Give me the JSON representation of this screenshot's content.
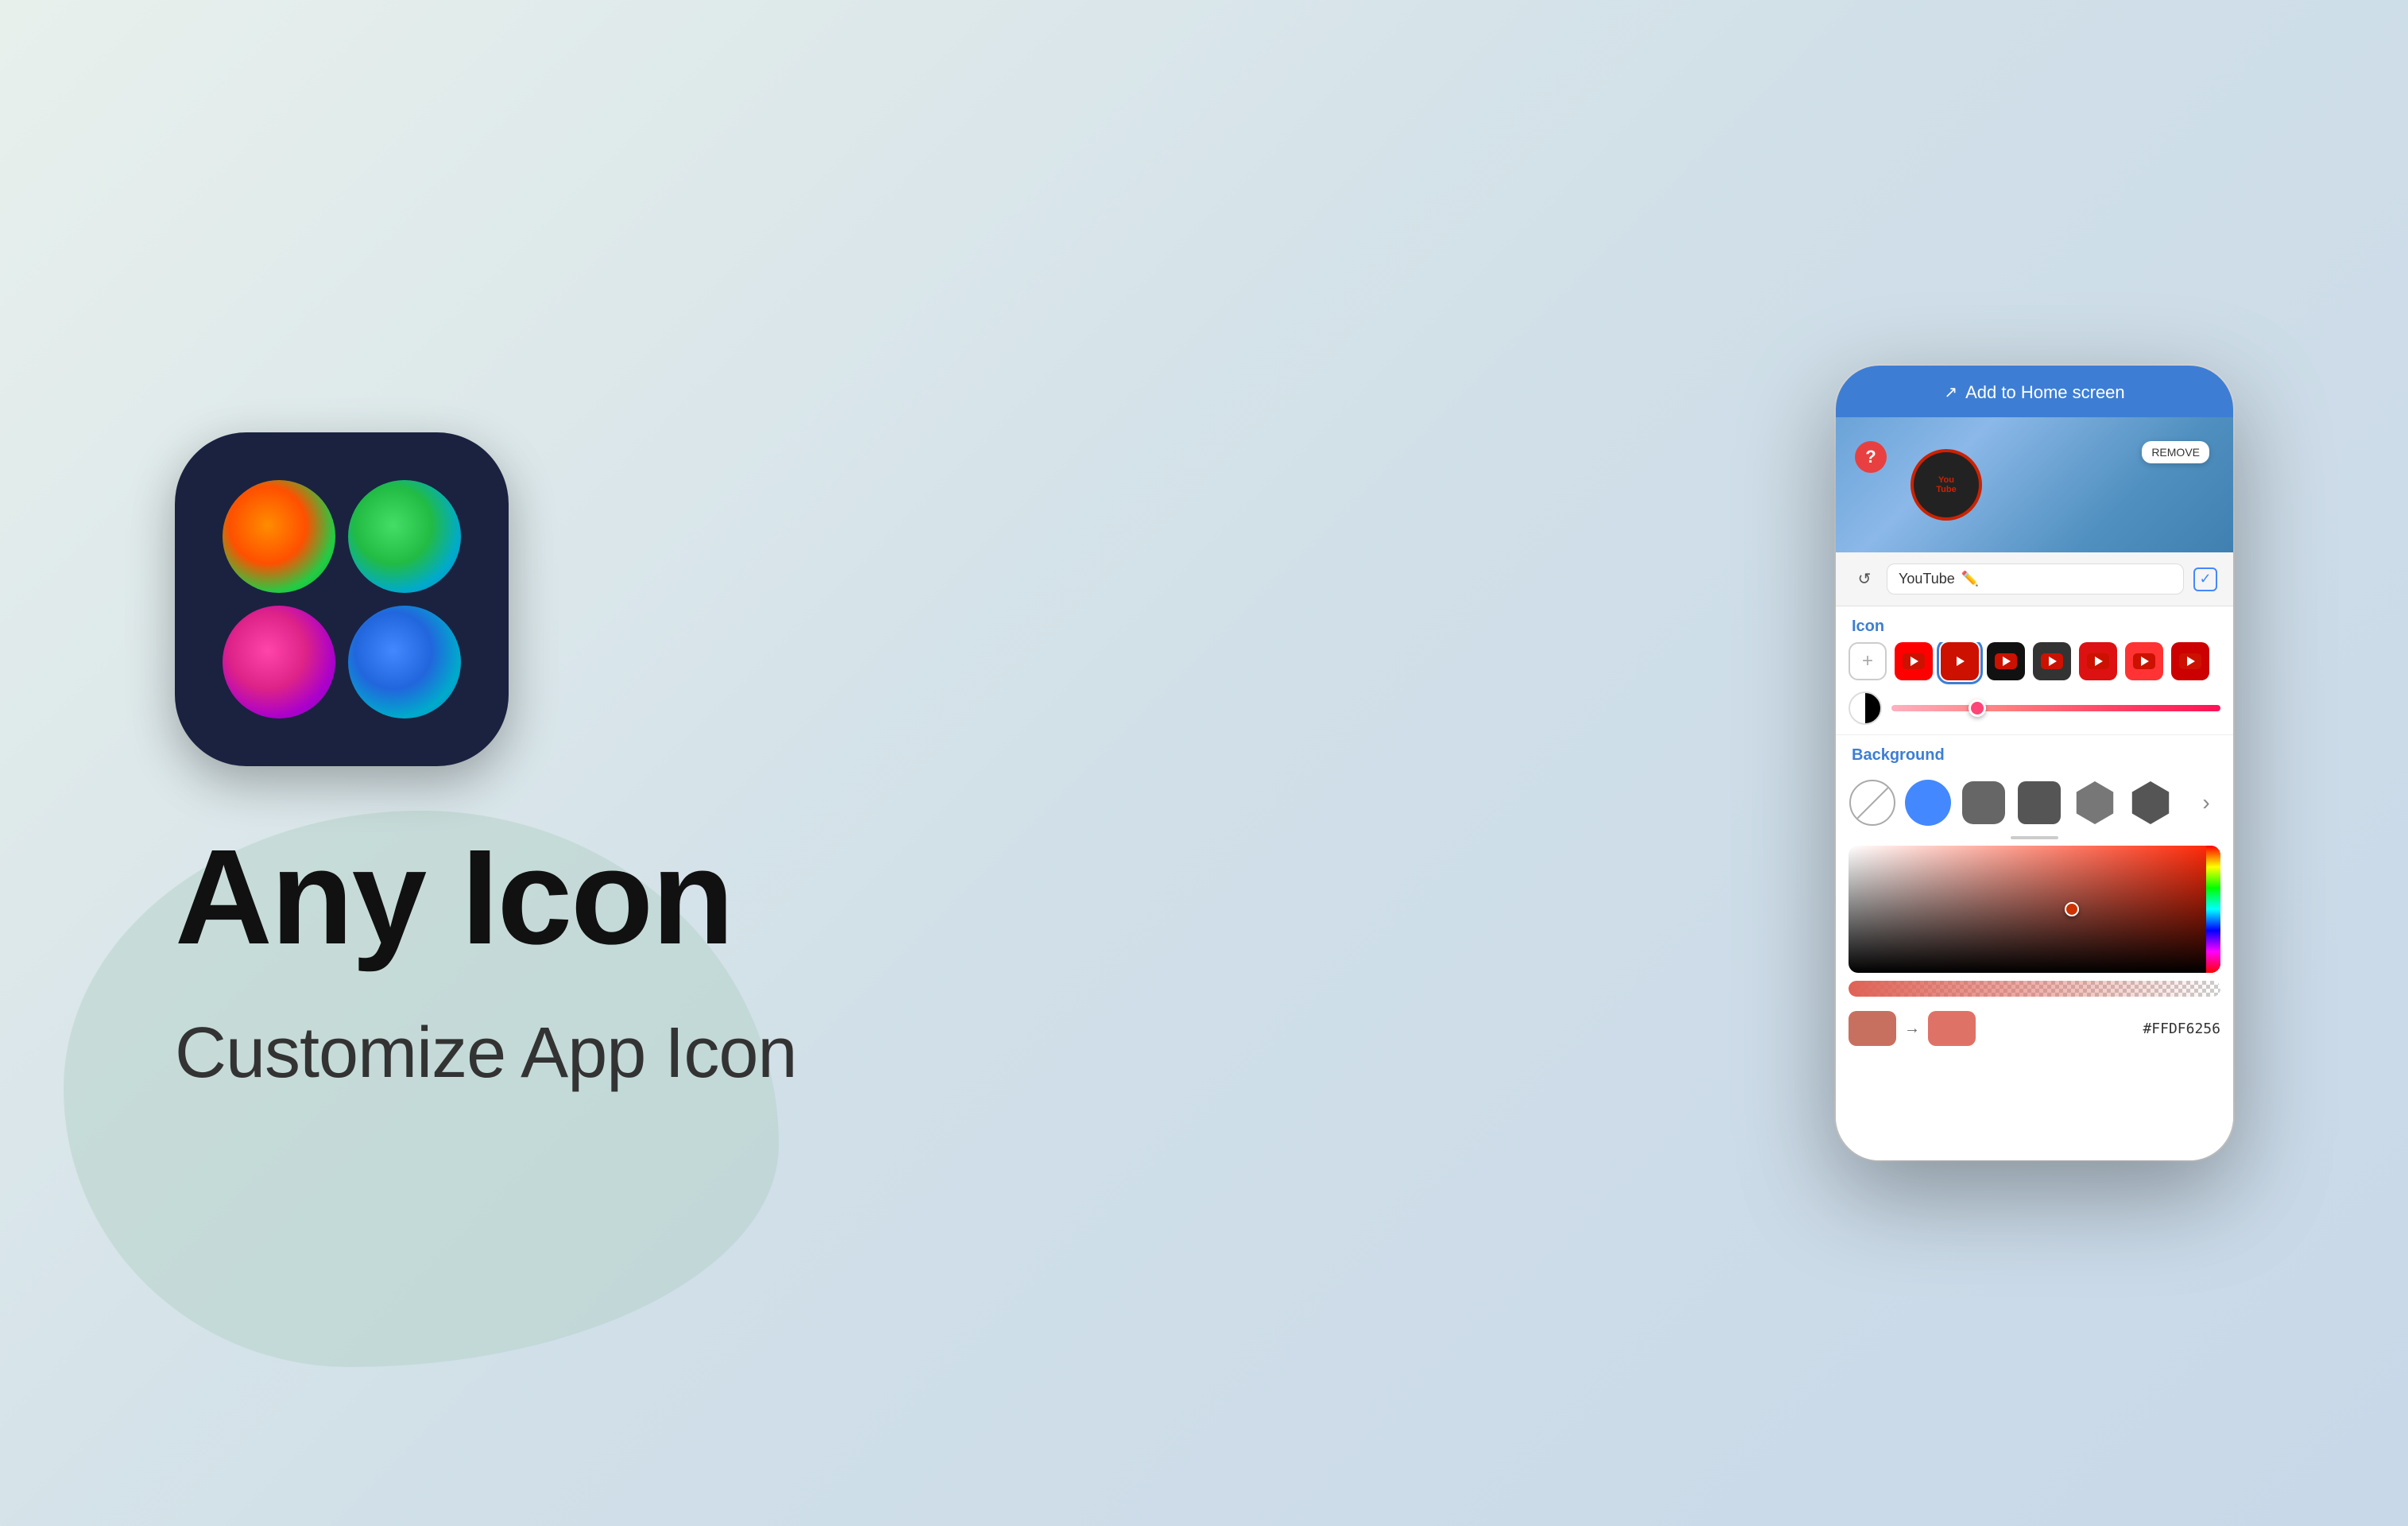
{
  "background": {
    "gradient_start": "#e8f0ec",
    "gradient_end": "#c8d8e8"
  },
  "app_icon": {
    "bg_color": "#1a2240",
    "border_radius": "90px"
  },
  "left": {
    "title": "Any Icon",
    "subtitle": "Customize App Icon"
  },
  "phone": {
    "top_bar": {
      "icon": "↗",
      "label": "Add to Home screen"
    },
    "preview": {
      "question_icon": "?",
      "youtube_name": "YouTube",
      "pencil_icon": "✏️",
      "remove_label": "REMOVE",
      "refresh_icon": "↺",
      "checkmark": "✓"
    },
    "icon_section": {
      "label": "Icon",
      "add_button": "+",
      "icons": [
        {
          "id": "yt-red",
          "label": "YouTube Red"
        },
        {
          "id": "yt-red-sq",
          "label": "YouTube Red Square"
        },
        {
          "id": "yt-dark",
          "label": "YouTube Dark"
        },
        {
          "id": "yt-dark2",
          "label": "YouTube Dark 2"
        },
        {
          "id": "yt-red2",
          "label": "YouTube Red 2"
        },
        {
          "id": "yt-red3",
          "label": "YouTube Red 3"
        },
        {
          "id": "yt-red4",
          "label": "YouTube Red 4"
        }
      ]
    },
    "background_section": {
      "label": "Background",
      "shapes": [
        {
          "id": "none",
          "label": "None"
        },
        {
          "id": "circle",
          "label": "Circle"
        },
        {
          "id": "rounded-square",
          "label": "Rounded Square"
        },
        {
          "id": "rounded-square-2",
          "label": "Rounded Square 2"
        },
        {
          "id": "hexagon",
          "label": "Hexagon"
        },
        {
          "id": "hexagon-2",
          "label": "Hexagon 2"
        },
        {
          "id": "more",
          "label": "More"
        }
      ]
    },
    "color_picker": {
      "hex_value": "#FFDF6256"
    }
  }
}
